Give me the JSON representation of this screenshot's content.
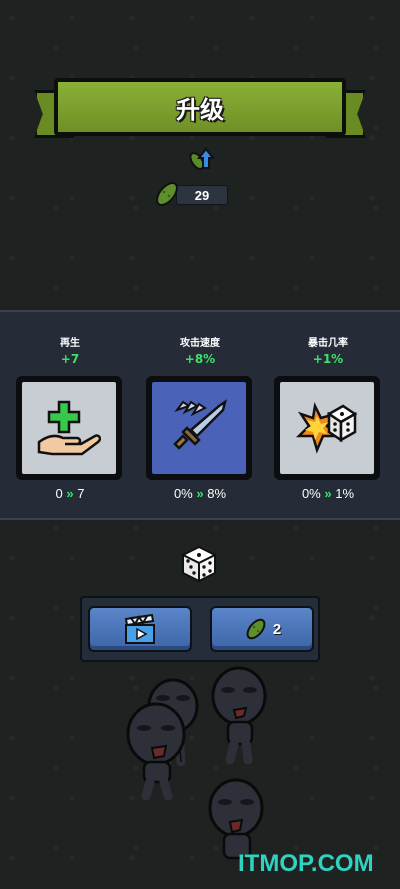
{
  "header": {
    "title": "升级"
  },
  "currency": {
    "pickles": "29",
    "icon": "pickle-icon"
  },
  "upgrades": [
    {
      "name": "再生",
      "bonus": "+7",
      "from": "0",
      "to": "7",
      "icon": "healing-hand-icon"
    },
    {
      "name": "攻击速度",
      "bonus": "+8%",
      "from": "0%",
      "to": "8%",
      "icon": "sword-icon"
    },
    {
      "name": "暴击几率",
      "bonus": "+1%",
      "from": "0%",
      "to": "1%",
      "icon": "crit-dice-icon"
    }
  ],
  "actions": {
    "reroll_cost": "2",
    "video_icon": "clapperboard-icon",
    "dice_icon": "dice-icon"
  },
  "watermark": "ITMOP.COM",
  "colors": {
    "banner_green": "#7a9d2e",
    "bonus_green": "#3ee06a",
    "button_blue": "#4a76bb",
    "panel_bg": "#252b37"
  }
}
